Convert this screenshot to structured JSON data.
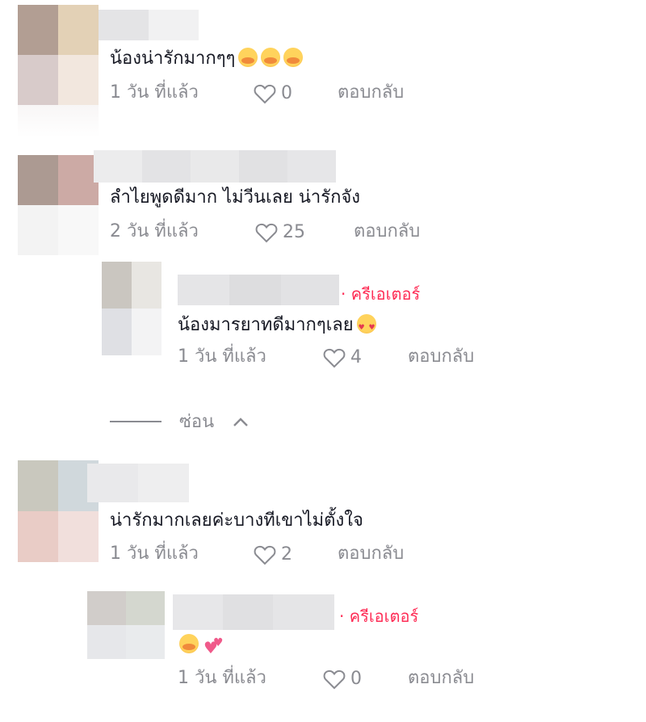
{
  "comments": [
    {
      "text": "น้องน่ารักมากๆๆ",
      "emojis": [
        "smiling-face-with-hearts-hug",
        "smiling-face-with-hearts-hug",
        "smiling-face-with-hearts-hug"
      ],
      "time": "1 วัน ที่แล้ว",
      "likes": "0",
      "reply_label": "ตอบกลับ"
    },
    {
      "text": "ลำไยพูดดีมาก ไม่วีนเลย น่ารักจัง",
      "time": "2 วัน ที่แล้ว",
      "likes": "25",
      "reply_label": "ตอบกลับ",
      "replies": [
        {
          "creator_label": "· ครีเอเตอร์",
          "text": "น้องมารยาทดีมากๆเลย",
          "emojis": [
            "heart-eyes"
          ],
          "time": "1 วัน ที่แล้ว",
          "likes": "4",
          "reply_label": "ตอบกลับ"
        }
      ],
      "hide_label": "ซ่อน"
    },
    {
      "text": "น่ารักมากเลยค่ะบางทีเขาไม่ตั้งใจ",
      "time": "1 วัน ที่แล้ว",
      "likes": "2",
      "reply_label": "ตอบกลับ",
      "replies": [
        {
          "creator_label": "· ครีเอเตอร์",
          "text": "",
          "emojis": [
            "smiling-face-with-hearts-hug",
            "two-hearts"
          ],
          "time": "1 วัน ที่แล้ว",
          "likes": "0",
          "reply_label": "ตอบกลับ"
        }
      ]
    }
  ],
  "colors": {
    "text": "#161823",
    "meta": "#8a8b91",
    "creator": "#fe2c55"
  },
  "icons": {
    "like": "heart-outline-icon",
    "hide": "chevron-up-icon"
  }
}
